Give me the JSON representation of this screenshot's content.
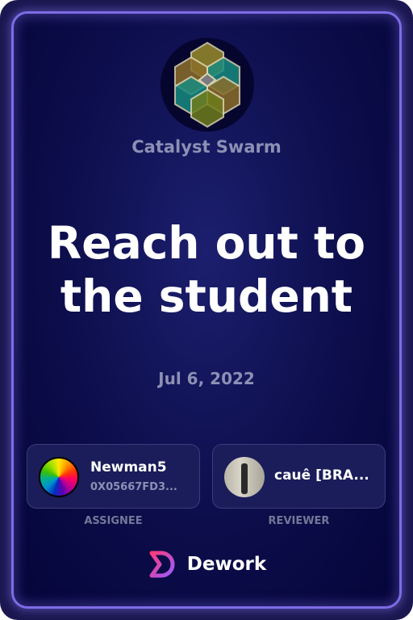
{
  "organization": {
    "name": "Catalyst Swarm",
    "logo": "hexagon-cluster-logo"
  },
  "task": {
    "title": "Reach out to the student",
    "date": "Jul 6, 2022"
  },
  "assignee": {
    "name": "Newman5",
    "address": "0X05667FD3...",
    "role_label": "ASSIGNEE"
  },
  "reviewer": {
    "name": "cauê [BRA...",
    "role_label": "REVIEWER"
  },
  "footer": {
    "brand": "Dework",
    "icon": "dework-logo-icon"
  },
  "colors": {
    "accent": "#7d6ce6",
    "background": "#05053a",
    "muted_text": "#8c90b4"
  }
}
